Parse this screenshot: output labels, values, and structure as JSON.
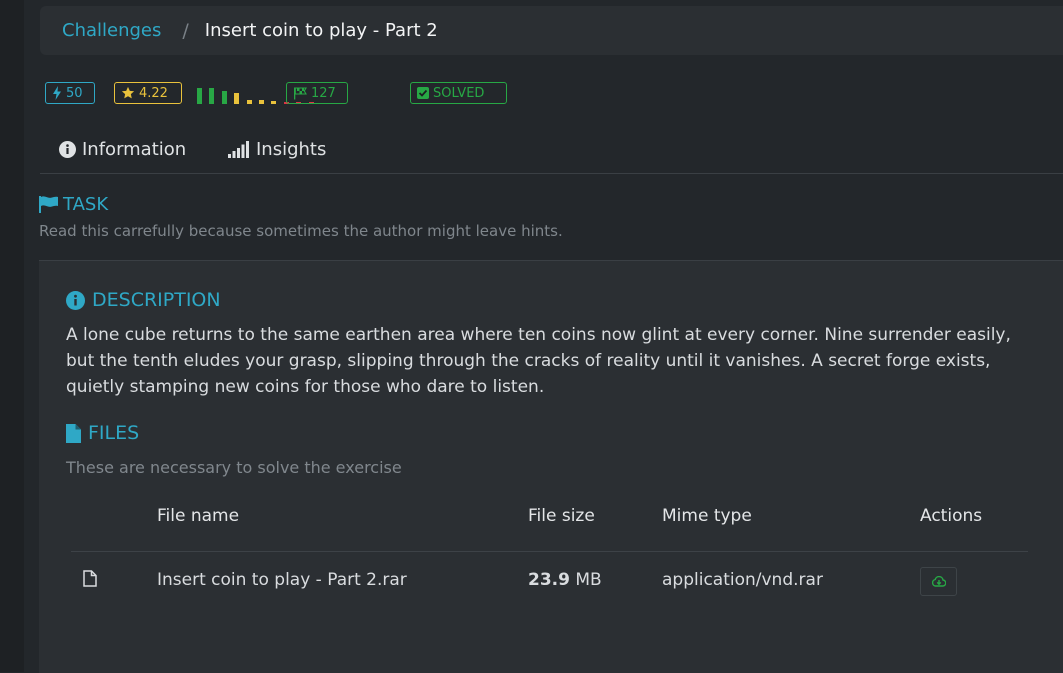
{
  "breadcrumb": {
    "root": "Challenges",
    "separator": "/",
    "current": "Insert coin to play - Part 2"
  },
  "badges": {
    "points": "50",
    "rating": "4.22",
    "solves": "127",
    "status": "SOLVED",
    "difficulty_distribution": [
      0.9,
      0.9,
      0.7,
      0.6,
      0.25,
      0.2,
      0.15,
      0.1,
      0.1,
      0.1
    ],
    "difficulty_colors": [
      "#28a745",
      "#28a745",
      "#28a745",
      "#e9c23c",
      "#e9c23c",
      "#e9c23c",
      "#e9c23c",
      "#dc3545",
      "#dc3545",
      "#dc3545"
    ]
  },
  "tabs": [
    {
      "label": "Information",
      "icon": "info-circle-icon"
    },
    {
      "label": "Insights",
      "icon": "signal-bars-icon"
    }
  ],
  "task": {
    "title": "TASK",
    "subtitle": "Read this carrefully because sometimes the author might leave hints."
  },
  "description": {
    "title": "DESCRIPTION",
    "text": "A lone cube returns to the same earthen area where ten coins now glint at every corner. Nine surrender easily, but the tenth eludes your grasp, slipping through the cracks of reality until it vanishes. A secret forge exists, quietly stamping new coins for those who dare to listen."
  },
  "files": {
    "title": "FILES",
    "subtitle": "These are necessary to solve the exercise",
    "headers": {
      "name": "File name",
      "size": "File size",
      "mime": "Mime type",
      "actions": "Actions"
    },
    "rows": [
      {
        "name": "Insert coin to play - Part 2.rar",
        "size_value": "23.9",
        "size_unit": "MB",
        "mime": "application/vnd.rar"
      }
    ]
  },
  "colors": {
    "accent": "#2fa8c6",
    "success": "#27a845",
    "rating": "#e9c23c",
    "background": "#23272b",
    "card": "#2b2f33"
  }
}
